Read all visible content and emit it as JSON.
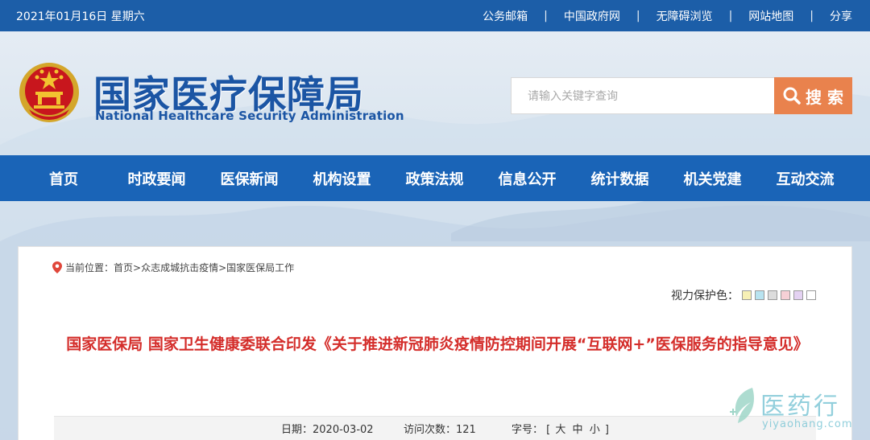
{
  "topbar": {
    "date": "2021年01月16日 星期六",
    "links": [
      "公务邮箱",
      "中国政府网",
      "无障碍浏览",
      "网站地图",
      "分享"
    ],
    "separator": "|"
  },
  "header": {
    "title_cn": "国家医疗保障局",
    "title_en": "National Healthcare Security Administration",
    "emblem_icon": "national-emblem-icon"
  },
  "search": {
    "placeholder": "请输入关键字查询",
    "button_label": "搜 索",
    "icon": "search-icon"
  },
  "nav": [
    "首页",
    "时政要闻",
    "医保新闻",
    "机构设置",
    "政策法规",
    "信息公开",
    "统计数据",
    "机关党建",
    "互动交流"
  ],
  "breadcrumb": {
    "prefix": "当前位置：",
    "items": [
      "首页",
      ">",
      "众志成城抗击疫情",
      ">",
      "国家医保局工作"
    ]
  },
  "vision": {
    "label": "视力保护色：",
    "swatches": [
      "#f7f0b5",
      "#b8e3f0",
      "#dcdcdc",
      "#f6d0d6",
      "#e4d2f2",
      "#ffffff"
    ]
  },
  "article": {
    "title": "国家医保局 国家卫生健康委联合印发《关于推进新冠肺炎疫情防控期间开展“互联网+”医保服务的指导意见》"
  },
  "meta": {
    "date_label": "日期：",
    "date": "2020-03-02",
    "visits_label": "访问次数：",
    "visits": "121",
    "font_label": "字号：",
    "font_open": "[",
    "font_sizes": [
      "大",
      "中",
      "小"
    ],
    "font_close": "]"
  },
  "watermark": {
    "cn": "医药行",
    "en": "yiyaohang.com"
  },
  "colors": {
    "topbar": "#1c5ea8",
    "nav": "#1a64b7",
    "brand": "#1b55a4",
    "search_button": "#e9824d",
    "title_red": "#d42d2a"
  }
}
